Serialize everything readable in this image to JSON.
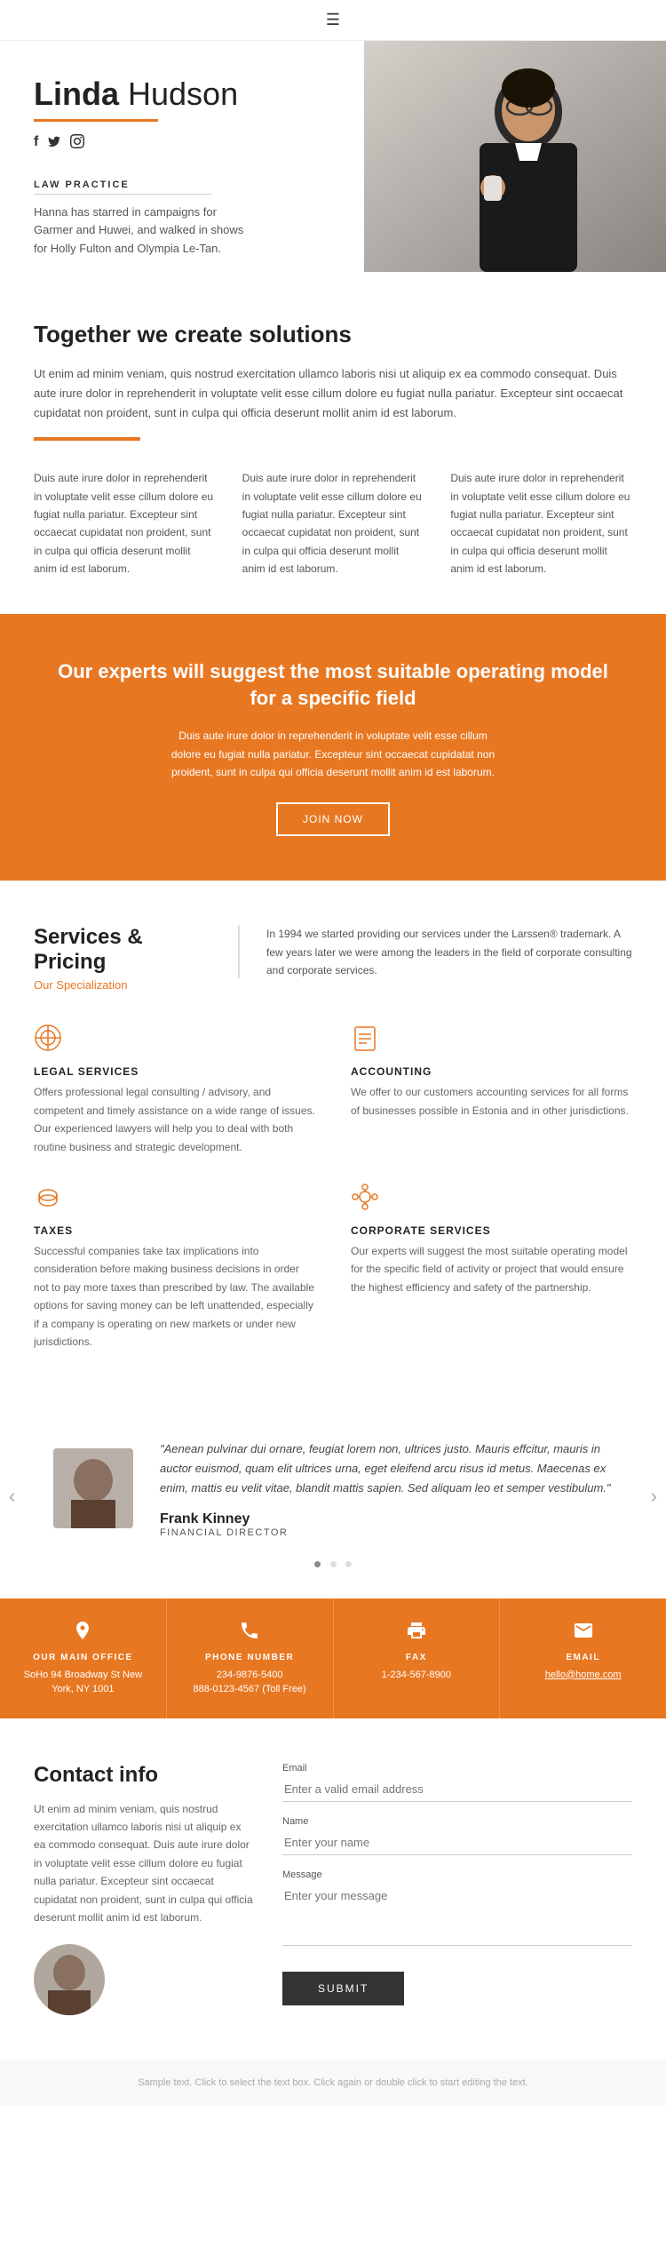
{
  "header": {
    "menu_icon": "☰"
  },
  "hero": {
    "name_first": "Linda",
    "name_last": " Hudson",
    "social_facebook": "f",
    "social_twitter": "t",
    "social_instagram": "i",
    "section_label": "LAW PRACTICE",
    "description": "Hanna has starred in campaigns for Garmer and Huwei, and walked in shows for Holly Fulton and Olympia Le-Tan."
  },
  "together": {
    "heading": "Together we create solutions",
    "paragraph": "Ut enim ad minim veniam, quis nostrud exercitation ullamco laboris nisi ut aliquip ex ea commodo consequat. Duis aute irure dolor in reprehenderit in voluptate velit esse cillum dolore eu fugiat nulla pariatur. Excepteur sint occaecat cupidatat non proident, sunt in culpa qui officia deserunt mollit anim id est laborum.",
    "col1": "Duis aute irure dolor in reprehenderit in voluptate velit esse cillum dolore eu fugiat nulla pariatur. Excepteur sint occaecat cupidatat non proident, sunt in culpa qui officia deserunt mollit anim id est laborum.",
    "col2": "Duis aute irure dolor in reprehenderit in voluptate velit esse cillum dolore eu fugiat nulla pariatur. Excepteur sint occaecat cupidatat non proident, sunt in culpa qui officia deserunt mollit anim id est laborum.",
    "col3": "Duis aute irure dolor in reprehenderit in voluptate velit esse cillum dolore eu fugiat nulla pariatur. Excepteur sint occaecat cupidatat non proident, sunt in culpa qui officia deserunt mollit anim id est laborum."
  },
  "banner": {
    "heading": "Our experts will suggest the most suitable operating model for a specific field",
    "paragraph": "Duis aute irure dolor in reprehenderit in voluptate velit esse cillum dolore eu fugiat nulla pariatur. Excepteur sint occaecat cupidatat non proident, sunt in culpa qui officia deserunt mollit anim id est laborum.",
    "btn_label": "JOIN NOW"
  },
  "services": {
    "heading": "Services & Pricing",
    "sub": "Our Specialization",
    "intro": "In 1994 we started providing our services under the Larssen® trademark. A few years later we were among the leaders in the field of corporate consulting and corporate services.",
    "items": [
      {
        "icon": "⚙",
        "title": "LEGAL SERVICES",
        "desc": "Offers professional legal consulting / advisory, and competent and timely assistance on a wide range of issues. Our experienced lawyers will help you to deal with both routine business and strategic development."
      },
      {
        "icon": "📄",
        "title": "ACCOUNTING",
        "desc": "We offer to our customers accounting services for all forms of businesses possible in Estonia and in other jurisdictions."
      },
      {
        "icon": "🗄",
        "title": "TAXES",
        "desc": "Successful companies take tax implications into consideration before making business decisions in order not to pay more taxes than prescribed by law. The available options for saving money can be left unattended, especially if a company is operating on new markets or under new jurisdictions."
      },
      {
        "icon": "⚙",
        "title": "CORPORATE SERVICES",
        "desc": "Our experts will suggest the most suitable operating model for the specific field of activity or project that would ensure the highest efficiency and safety of the partnership."
      }
    ]
  },
  "testimonial": {
    "quote": "\"Aenean pulvinar dui ornare, feugiat lorem non, ultrices justo. Mauris effcitur, mauris in auctor euismod, quam elit ultrices urna, eget eleifend arcu risus id metus. Maecenas ex enim, mattis eu velit vitae, blandit mattis sapien. Sed aliquam leo et semper vestibulum.\"",
    "name": "Frank Kinney",
    "role": "FINANCIAL DIRECTOR",
    "dots": [
      "active",
      "",
      ""
    ]
  },
  "info_bar": {
    "items": [
      {
        "icon": "📍",
        "label": "OUR MAIN OFFICE",
        "value": "SoHo 94 Broadway St New York, NY 1001"
      },
      {
        "icon": "📞",
        "label": "PHONE NUMBER",
        "value": "234-9876-5400\n888-0123-4567 (Toll Free)"
      },
      {
        "icon": "📠",
        "label": "FAX",
        "value": "1-234-567-8900"
      },
      {
        "icon": "✉",
        "label": "EMAIL",
        "value": "hello@home.com"
      }
    ]
  },
  "contact": {
    "heading": "Contact info",
    "paragraph": "Ut enim ad minim veniam, quis nostrud exercitation ullamco laboris nisi ut aliquip ex ea commodo consequat. Duis aute irure dolor in voluptate velit esse cillum dolore eu fugiat nulla pariatur. Excepteur sint occaecat cupidatat non proident, sunt in culpa qui officia deserunt mollit anim id est laborum.",
    "form": {
      "email_label": "Email",
      "email_placeholder": "Enter a valid email address",
      "name_label": "Name",
      "name_placeholder": "Enter your name",
      "message_label": "Message",
      "message_placeholder": "Enter your message",
      "submit_label": "SUBMIT"
    }
  },
  "footer": {
    "note": "Sample text. Click to select the text box. Click again or double click to start editing the text."
  }
}
